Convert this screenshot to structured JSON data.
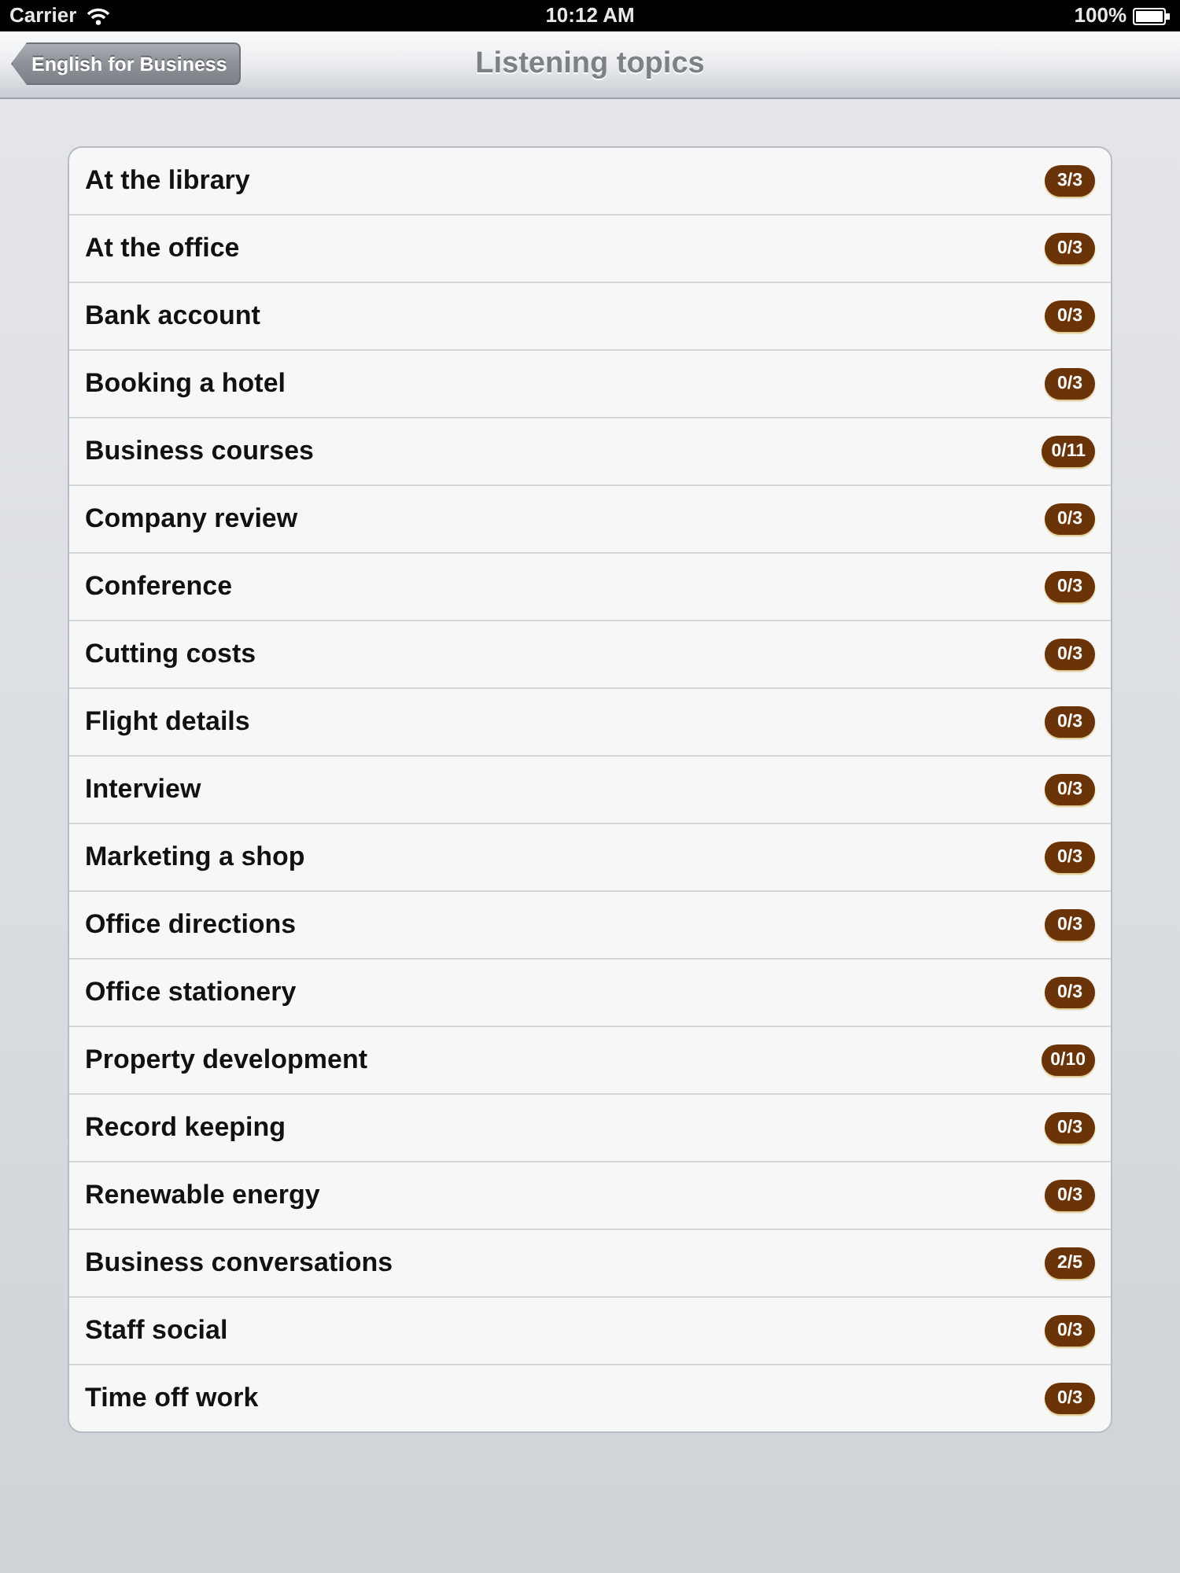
{
  "status_bar": {
    "carrier": "Carrier",
    "time": "10:12 AM",
    "battery": "100%"
  },
  "nav_bar": {
    "back_button": "English for Business",
    "title": "Listening topics"
  },
  "topics": [
    {
      "label": "At the library",
      "count": "3/3"
    },
    {
      "label": "At the office",
      "count": "0/3"
    },
    {
      "label": "Bank account",
      "count": "0/3"
    },
    {
      "label": "Booking a hotel",
      "count": "0/3"
    },
    {
      "label": "Business courses",
      "count": "0/11"
    },
    {
      "label": "Company review",
      "count": "0/3"
    },
    {
      "label": "Conference",
      "count": "0/3"
    },
    {
      "label": "Cutting costs",
      "count": "0/3"
    },
    {
      "label": "Flight details",
      "count": "0/3"
    },
    {
      "label": "Interview",
      "count": "0/3"
    },
    {
      "label": "Marketing a shop",
      "count": "0/3"
    },
    {
      "label": "Office directions",
      "count": "0/3"
    },
    {
      "label": "Office stationery",
      "count": "0/3"
    },
    {
      "label": "Property development",
      "count": "0/10"
    },
    {
      "label": "Record keeping",
      "count": "0/3"
    },
    {
      "label": "Renewable energy",
      "count": "0/3"
    },
    {
      "label": "Business conversations",
      "count": "2/5"
    },
    {
      "label": "Staff social",
      "count": "0/3"
    },
    {
      "label": "Time off work",
      "count": "0/3"
    }
  ]
}
